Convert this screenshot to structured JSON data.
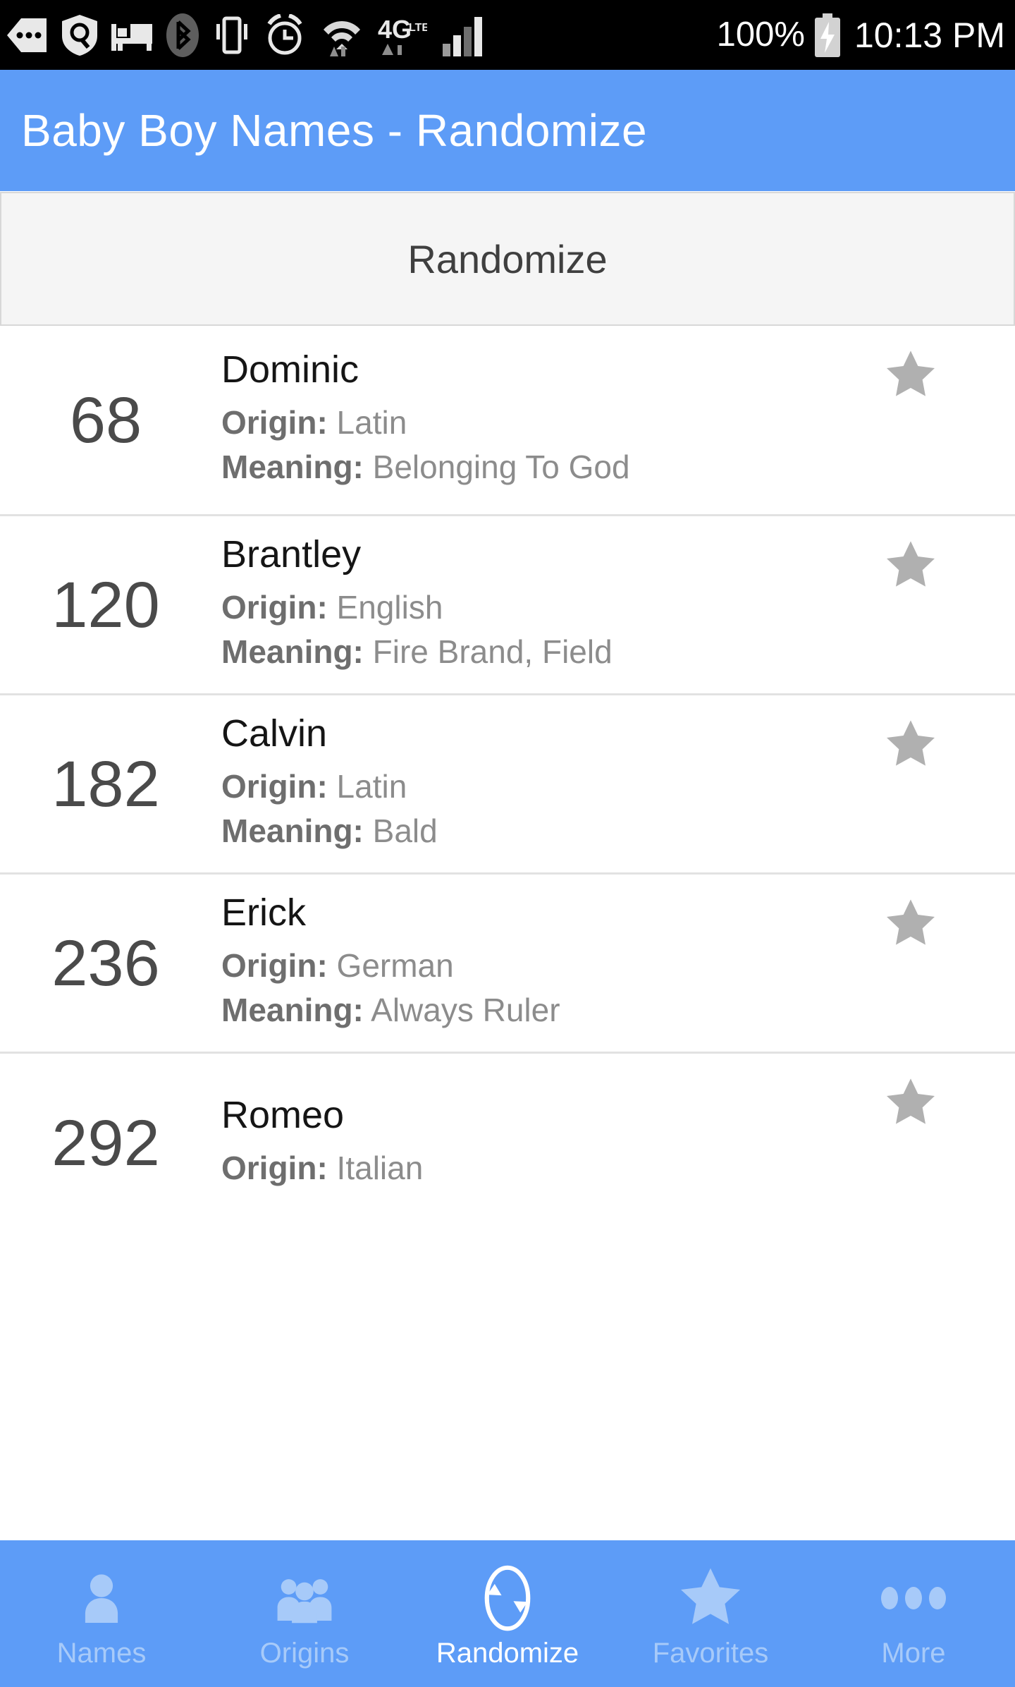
{
  "status_bar": {
    "icons": [
      "back-arrow-icon",
      "shield-search-icon",
      "do-not-disturb-bed-icon",
      "bluetooth-icon",
      "vibrate-icon",
      "alarm-icon",
      "wifi-icon",
      "network-4glte-icon",
      "signal-bars-icon"
    ],
    "battery_percent": "100%",
    "battery_state": "charging",
    "time": "10:13 PM"
  },
  "header": {
    "title": "Baby Boy Names - Randomize",
    "background_color": "#5d9cf7",
    "text_color": "#ffffff"
  },
  "randomize_button": {
    "label": "Randomize",
    "background_color": "#f5f5f5",
    "border_color": "#d8d8d8",
    "text_color": "#3f3f3f"
  },
  "labels": {
    "origin": "Origin:",
    "meaning": "Meaning:"
  },
  "list": {
    "star_color": "#b0b0b0",
    "items": [
      {
        "rank": "68",
        "name": "Dominic",
        "origin": "Latin",
        "meaning": "Belonging To God",
        "favorite_icon": "star-icon"
      },
      {
        "rank": "120",
        "name": "Brantley",
        "origin": "English",
        "meaning": "Fire Brand, Field",
        "favorite_icon": "star-icon"
      },
      {
        "rank": "182",
        "name": "Calvin",
        "origin": "Latin",
        "meaning": "Bald",
        "favorite_icon": "star-icon"
      },
      {
        "rank": "236",
        "name": "Erick",
        "origin": "German",
        "meaning": "Always Ruler",
        "favorite_icon": "star-icon"
      },
      {
        "rank": "292",
        "name": "Romeo",
        "origin": "Italian",
        "meaning": "",
        "favorite_icon": "star-icon"
      }
    ]
  },
  "tab_bar": {
    "background_color": "#5d9cf7",
    "active_color": "#ffffff",
    "inactive_color": "#a7caf9",
    "tabs": [
      {
        "label": "Names",
        "icon": "person-icon",
        "active": false
      },
      {
        "label": "Origins",
        "icon": "people-group-icon",
        "active": false
      },
      {
        "label": "Randomize",
        "icon": "refresh-circular-arrows-icon",
        "active": true
      },
      {
        "label": "Favorites",
        "icon": "star-icon",
        "active": false
      },
      {
        "label": "More",
        "icon": "three-dots-icon",
        "active": false
      }
    ]
  }
}
